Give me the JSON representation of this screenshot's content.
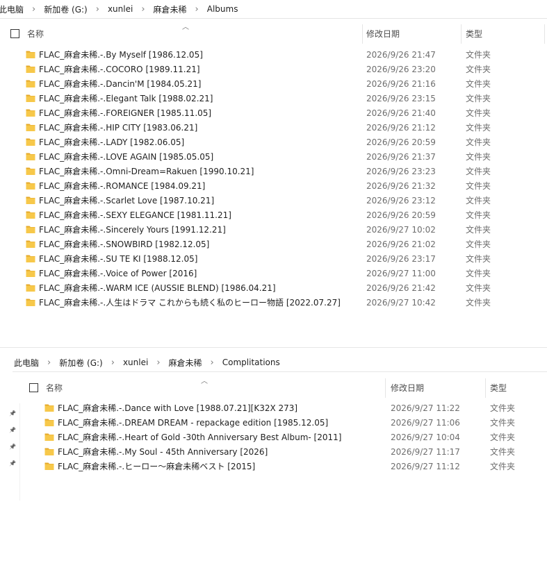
{
  "pane1": {
    "breadcrumb": [
      "此电脑",
      "新加卷 (G:)",
      "xunlei",
      "麻倉未稀",
      "Albums"
    ],
    "columns": {
      "name": "名称",
      "date": "修改日期",
      "type": "类型"
    },
    "items": [
      {
        "name": "FLAC_麻倉未稀.-.By Myself [1986.12.05]",
        "date": "2026/9/26 21:47",
        "type": "文件夹"
      },
      {
        "name": "FLAC_麻倉未稀.-.COCORO [1989.11.21]",
        "date": "2026/9/26 23:20",
        "type": "文件夹"
      },
      {
        "name": "FLAC_麻倉未稀.-.Dancin'M [1984.05.21]",
        "date": "2026/9/26 21:16",
        "type": "文件夹"
      },
      {
        "name": "FLAC_麻倉未稀.-.Elegant Talk [1988.02.21]",
        "date": "2026/9/26 23:15",
        "type": "文件夹"
      },
      {
        "name": "FLAC_麻倉未稀.-.FOREIGNER [1985.11.05]",
        "date": "2026/9/26 21:40",
        "type": "文件夹"
      },
      {
        "name": "FLAC_麻倉未稀.-.HIP CITY [1983.06.21]",
        "date": "2026/9/26 21:12",
        "type": "文件夹"
      },
      {
        "name": "FLAC_麻倉未稀.-.LADY [1982.06.05]",
        "date": "2026/9/26 20:59",
        "type": "文件夹"
      },
      {
        "name": "FLAC_麻倉未稀.-.LOVE AGAIN [1985.05.05]",
        "date": "2026/9/26 21:37",
        "type": "文件夹"
      },
      {
        "name": "FLAC_麻倉未稀.-.Omni-Dream=Rakuen [1990.10.21]",
        "date": "2026/9/26 23:23",
        "type": "文件夹"
      },
      {
        "name": "FLAC_麻倉未稀.-.ROMANCE [1984.09.21]",
        "date": "2026/9/26 21:32",
        "type": "文件夹"
      },
      {
        "name": "FLAC_麻倉未稀.-.Scarlet Love [1987.10.21]",
        "date": "2026/9/26 23:12",
        "type": "文件夹"
      },
      {
        "name": "FLAC_麻倉未稀.-.SEXY ELEGANCE [1981.11.21]",
        "date": "2026/9/26 20:59",
        "type": "文件夹"
      },
      {
        "name": "FLAC_麻倉未稀.-.Sincerely Yours [1991.12.21]",
        "date": "2026/9/27 10:02",
        "type": "文件夹"
      },
      {
        "name": "FLAC_麻倉未稀.-.SNOWBIRD [1982.12.05]",
        "date": "2026/9/26 21:02",
        "type": "文件夹"
      },
      {
        "name": "FLAC_麻倉未稀.-.SU TE KI [1988.12.05]",
        "date": "2026/9/26 23:17",
        "type": "文件夹"
      },
      {
        "name": "FLAC_麻倉未稀.-.Voice of Power [2016]",
        "date": "2026/9/27 11:00",
        "type": "文件夹"
      },
      {
        "name": "FLAC_麻倉未稀.-.WARM ICE (AUSSIE BLEND) [1986.04.21]",
        "date": "2026/9/26 21:42",
        "type": "文件夹"
      },
      {
        "name": "FLAC_麻倉未稀.-.人生はドラマ これからも続く私のヒーロー物語 [2022.07.27]",
        "date": "2026/9/27 10:42",
        "type": "文件夹"
      }
    ]
  },
  "pane2": {
    "breadcrumb": [
      "此电脑",
      "新加卷 (G:)",
      "xunlei",
      "麻倉未稀",
      "Complitations"
    ],
    "columns": {
      "name": "名称",
      "date": "修改日期",
      "type": "类型"
    },
    "items": [
      {
        "name": "FLAC_麻倉未稀.-.Dance with Love [1988.07.21][K32X 273]",
        "date": "2026/9/27 11:22",
        "type": "文件夹"
      },
      {
        "name": "FLAC_麻倉未稀.-.DREAM DREAM - repackage edition [1985.12.05]",
        "date": "2026/9/27 11:06",
        "type": "文件夹"
      },
      {
        "name": "FLAC_麻倉未稀.-.Heart of Gold -30th Anniversary Best Album- [2011]",
        "date": "2026/9/27 10:04",
        "type": "文件夹"
      },
      {
        "name": "FLAC_麻倉未稀.-.My Soul - 45th Anniversary [2026]",
        "date": "2026/9/27 11:17",
        "type": "文件夹"
      },
      {
        "name": "FLAC_麻倉未稀.-.ヒーロー～麻倉未稀ベスト [2015]",
        "date": "2026/9/27 11:12",
        "type": "文件夹"
      }
    ]
  },
  "icons": {
    "folder": "folder-icon",
    "pin": "pin-icon",
    "sort": "sort-up-icon",
    "separator": "chevron-right-icon"
  },
  "colors": {
    "folder": "#f7c84a",
    "folder_dark": "#e5a92a",
    "header_text": "#4c4c4c",
    "secondary_text": "#6d6d6d"
  }
}
